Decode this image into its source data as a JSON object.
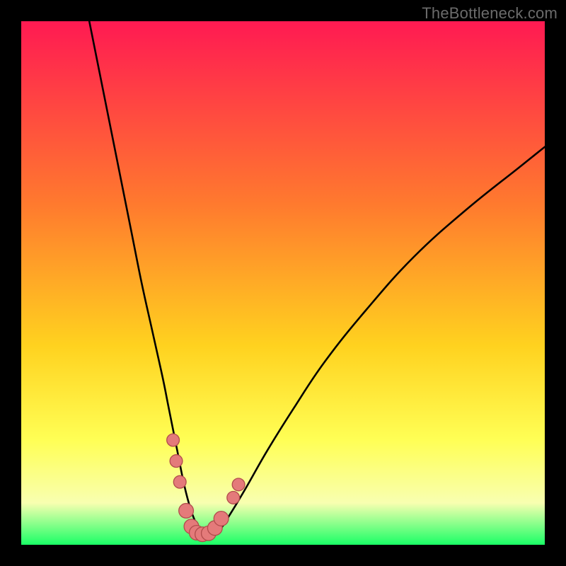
{
  "watermark": "TheBottleneck.com",
  "palette": {
    "black": "#000000",
    "grad_top": "#ff1a52",
    "grad_upper_mid": "#ff7a2e",
    "grad_mid": "#ffd21f",
    "grad_lower_mid": "#ffff55",
    "grad_pale": "#f8ffb0",
    "grad_green": "#1aff66",
    "curve": "#000000",
    "marker_fill": "#e47a7a",
    "marker_stroke": "#b24d4d"
  },
  "chart_data": {
    "type": "line",
    "title": "",
    "xlabel": "",
    "ylabel": "",
    "xlim": [
      0,
      100
    ],
    "ylim": [
      0,
      100
    ],
    "series": [
      {
        "name": "bottleneck-curve",
        "x": [
          13,
          15,
          17,
          19,
          21,
          23,
          25,
          27,
          28,
          29,
          30,
          31,
          32,
          33,
          34,
          35,
          36,
          38,
          40,
          43,
          47,
          52,
          58,
          66,
          75,
          85,
          95,
          100
        ],
        "y": [
          100,
          90,
          80,
          70,
          60,
          50,
          41,
          32,
          27,
          22,
          17,
          12,
          8,
          5,
          3,
          2,
          2,
          3,
          6,
          11,
          18,
          26,
          35,
          45,
          55,
          64,
          72,
          76
        ]
      }
    ],
    "markers": [
      {
        "x": 29.0,
        "y": 20.0,
        "r": 1.2
      },
      {
        "x": 29.6,
        "y": 16.0,
        "r": 1.2
      },
      {
        "x": 30.3,
        "y": 12.0,
        "r": 1.2
      },
      {
        "x": 31.5,
        "y": 6.5,
        "r": 1.4
      },
      {
        "x": 32.5,
        "y": 3.5,
        "r": 1.4
      },
      {
        "x": 33.5,
        "y": 2.3,
        "r": 1.4
      },
      {
        "x": 34.6,
        "y": 2.0,
        "r": 1.4
      },
      {
        "x": 35.8,
        "y": 2.2,
        "r": 1.4
      },
      {
        "x": 37.0,
        "y": 3.2,
        "r": 1.4
      },
      {
        "x": 38.2,
        "y": 5.0,
        "r": 1.4
      },
      {
        "x": 40.5,
        "y": 9.0,
        "r": 1.2
      },
      {
        "x": 41.5,
        "y": 11.5,
        "r": 1.2
      }
    ]
  }
}
